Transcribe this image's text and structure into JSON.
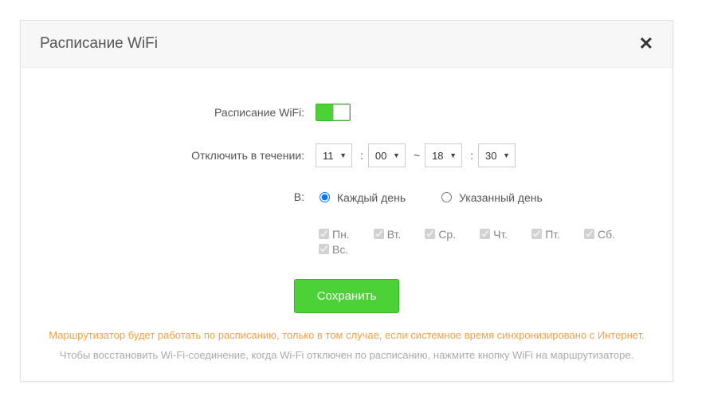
{
  "header": {
    "title": "Расписание WiFi"
  },
  "form": {
    "schedule_label": "Расписание WiFi:",
    "schedule_enabled": true,
    "disable_label": "Отключить в течении:",
    "time": {
      "from_hour": "11",
      "from_min": "00",
      "to_hour": "18",
      "to_min": "30"
    },
    "repeat_label": "В:",
    "repeat_options": {
      "every": "Каждый день",
      "selected": "Указанный день"
    },
    "days": {
      "mon": "Пн.",
      "tue": "Вт.",
      "wed": "Ср.",
      "thu": "Чт.",
      "fri": "Пт.",
      "sat": "Сб.",
      "sun": "Вс."
    },
    "save": "Сохранить"
  },
  "notes": {
    "warn": "Маршрутизатор будет работать по расписанию, только в том случае, если системное время синхронизировано с Интернет.",
    "tip": "Чтобы восстановить Wi-Fi-соединение, когда Wi-Fi отключен по расписанию, нажмите кнопку WiFi на маршрутизаторе."
  }
}
